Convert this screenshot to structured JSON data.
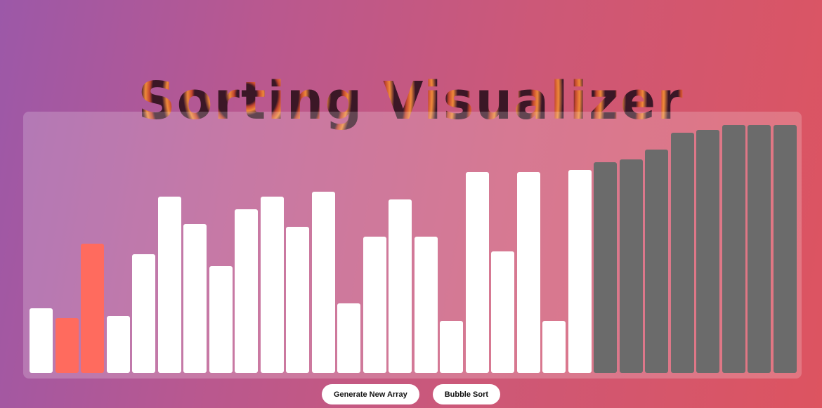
{
  "header": {
    "title": "Sorting Visualizer"
  },
  "colors": {
    "unsorted": "#ffffff",
    "comparing": "#ff6b5e",
    "sorted": "#6b6b6b"
  },
  "chart_data": {
    "type": "bar",
    "ylim": [
      0,
      100
    ],
    "values": [
      26,
      22,
      52,
      23,
      48,
      71,
      60,
      43,
      66,
      71,
      59,
      73,
      28,
      55,
      70,
      55,
      21,
      81,
      49,
      81,
      21,
      82,
      85,
      86,
      90,
      97,
      98,
      100,
      100,
      100
    ],
    "states": [
      "unsorted",
      "comparing",
      "comparing",
      "unsorted",
      "unsorted",
      "unsorted",
      "unsorted",
      "unsorted",
      "unsorted",
      "unsorted",
      "unsorted",
      "unsorted",
      "unsorted",
      "unsorted",
      "unsorted",
      "unsorted",
      "unsorted",
      "unsorted",
      "unsorted",
      "unsorted",
      "unsorted",
      "unsorted",
      "sorted",
      "sorted",
      "sorted",
      "sorted",
      "sorted",
      "sorted",
      "sorted",
      "sorted"
    ]
  },
  "controls": {
    "generate_label": "Generate New Array",
    "sort_label": "Bubble Sort"
  }
}
